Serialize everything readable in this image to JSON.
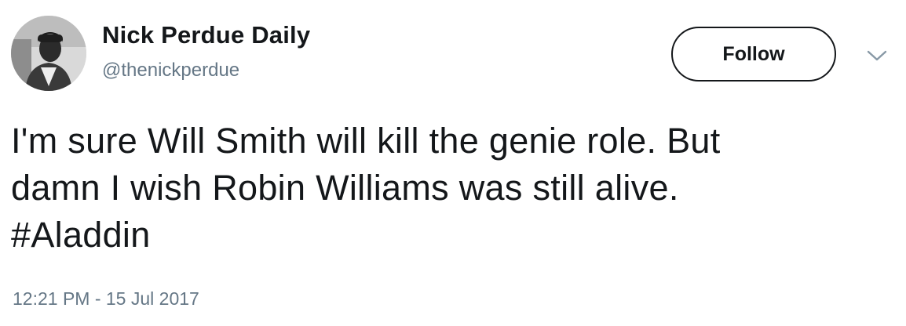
{
  "user": {
    "display_name": "Nick Perdue Daily",
    "handle": "@thenickperdue"
  },
  "actions": {
    "follow_label": "Follow",
    "more_icon": "chevron-down-icon"
  },
  "tweet": {
    "lines": [
      "I'm sure Will Smith will kill the genie role. But",
      "damn I wish Robin Williams was still alive."
    ],
    "hashtag": "#Aladdin",
    "timestamp": "12:21 PM - 15 Jul 2017"
  },
  "colors": {
    "text_primary": "#14171a",
    "text_secondary": "#657786",
    "button_border": "#14171a",
    "background": "#ffffff"
  }
}
